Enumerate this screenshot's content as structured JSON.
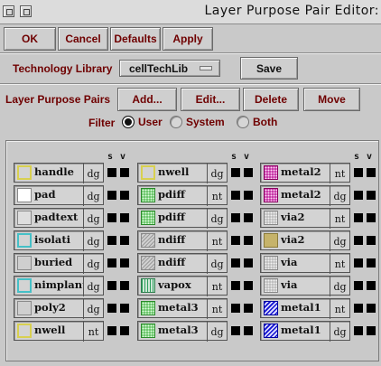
{
  "window": {
    "title": "Layer Purpose Pair Editor:"
  },
  "toolbar": {
    "ok_label": "OK",
    "cancel_label": "Cancel",
    "defaults_label": "Defaults",
    "apply_label": "Apply"
  },
  "tech": {
    "label": "Technology Library",
    "library_value": "cellTechLib",
    "save_label": "Save"
  },
  "pairs": {
    "label": "Layer Purpose Pairs",
    "add_label": "Add...",
    "edit_label": "Edit...",
    "delete_label": "Delete",
    "move_label": "Move"
  },
  "filter": {
    "label": "Filter",
    "options": [
      "User",
      "System",
      "Both"
    ],
    "selected": "User"
  },
  "grid": {
    "col_headers": {
      "s": "s",
      "v": "v"
    },
    "columns": [
      [
        {
          "layer": "handle",
          "purpose": "dg",
          "pattern": "outline-yellow"
        },
        {
          "layer": "pad",
          "purpose": "dg",
          "pattern": "solid-white"
        },
        {
          "layer": "padtext",
          "purpose": "dg",
          "pattern": "solid-light"
        },
        {
          "layer": "isolati",
          "purpose": "dg",
          "pattern": "outline-cyan"
        },
        {
          "layer": "buried",
          "purpose": "dg",
          "pattern": "outline-gray"
        },
        {
          "layer": "nimplant",
          "purpose": "dg",
          "pattern": "outline-cyan"
        },
        {
          "layer": "poly2",
          "purpose": "dg",
          "pattern": "outline-gray"
        },
        {
          "layer": "nwell",
          "purpose": "nt",
          "pattern": "outline-yellow"
        }
      ],
      [
        {
          "layer": "nwell",
          "purpose": "dg",
          "pattern": "outline-yellow"
        },
        {
          "layer": "pdiff",
          "purpose": "nt",
          "pattern": "dots-green"
        },
        {
          "layer": "pdiff",
          "purpose": "dg",
          "pattern": "dots-green"
        },
        {
          "layer": "ndiff",
          "purpose": "nt",
          "pattern": "diag-gray"
        },
        {
          "layer": "ndiff",
          "purpose": "dg",
          "pattern": "diag-gray"
        },
        {
          "layer": "vapox",
          "purpose": "nt",
          "pattern": "vert-green"
        },
        {
          "layer": "metal3",
          "purpose": "nt",
          "pattern": "dots-green"
        },
        {
          "layer": "metal3",
          "purpose": "dg",
          "pattern": "dots-green"
        }
      ],
      [
        {
          "layer": "metal2",
          "purpose": "nt",
          "pattern": "dots-magenta"
        },
        {
          "layer": "metal2",
          "purpose": "dg",
          "pattern": "dots-magenta"
        },
        {
          "layer": "via2",
          "purpose": "nt",
          "pattern": "dots-gray"
        },
        {
          "layer": "via2",
          "purpose": "dg",
          "pattern": "solid-olive"
        },
        {
          "layer": "via",
          "purpose": "nt",
          "pattern": "dots-gray"
        },
        {
          "layer": "via",
          "purpose": "dg",
          "pattern": "dots-gray"
        },
        {
          "layer": "metal1",
          "purpose": "nt",
          "pattern": "diag-blue"
        },
        {
          "layer": "metal1",
          "purpose": "dg",
          "pattern": "diag-blue"
        }
      ]
    ]
  },
  "colors": {
    "label_dark_red": "#6f0000",
    "background": "#c9c9c9"
  }
}
